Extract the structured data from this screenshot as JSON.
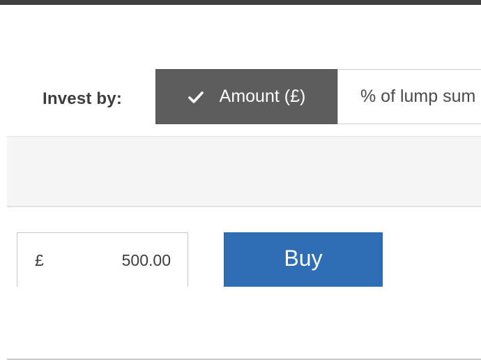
{
  "invest_by": {
    "label": "Invest by:",
    "options": [
      {
        "label": "Amount (£)",
        "selected": true,
        "icon": "check-icon"
      },
      {
        "label": "% of lump sum",
        "selected": false
      }
    ]
  },
  "order": {
    "currency_symbol": "£",
    "amount_value": "500.00",
    "buy_label": "Buy"
  },
  "colors": {
    "selected_toggle_bg": "#5d5d5d",
    "buy_button_bg": "#2f6eb4",
    "top_bar": "#3f3f3f"
  }
}
